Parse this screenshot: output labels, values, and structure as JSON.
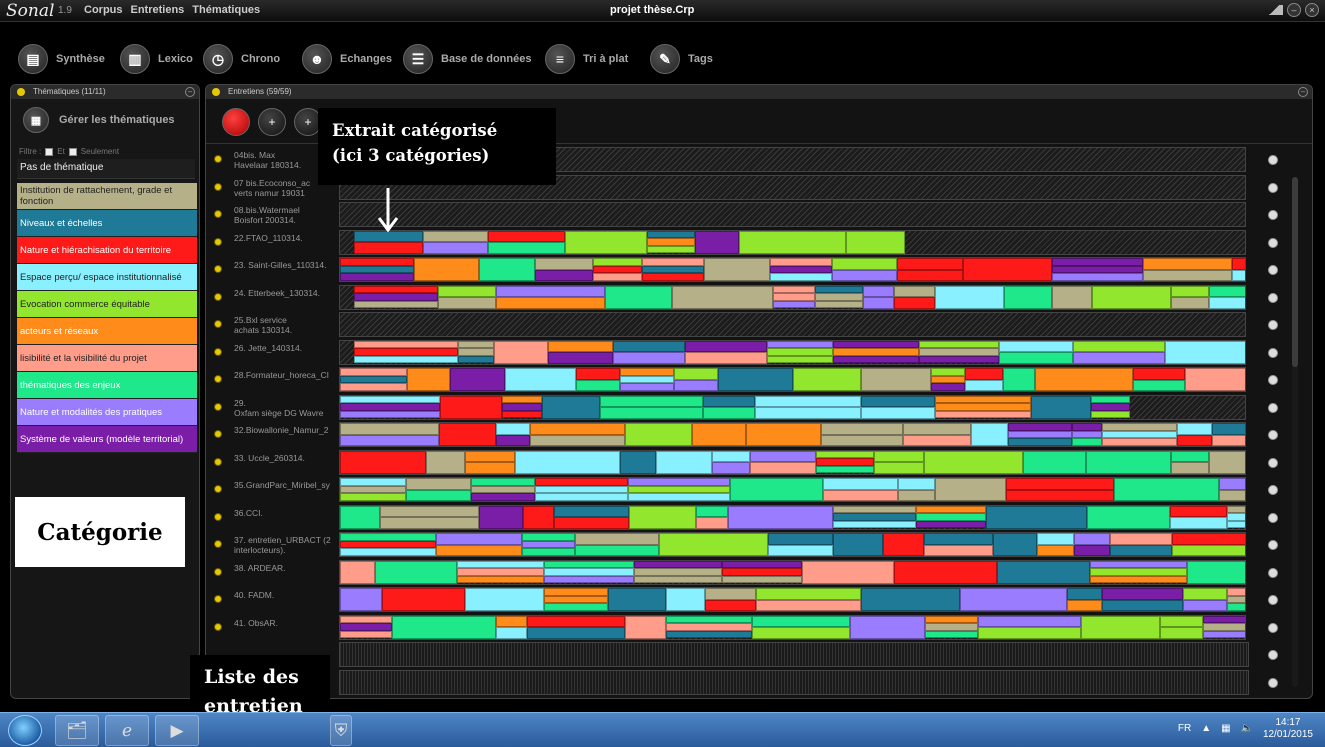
{
  "window": {
    "logo": "Sonal",
    "version": "1.9",
    "menu": [
      "Corpus",
      "Entretiens",
      "Thématiques"
    ],
    "title": "projet thèse.Crp"
  },
  "toolbar": [
    {
      "label": "Synthèse",
      "icon": "document-icon"
    },
    {
      "label": "Lexico",
      "icon": "lexicon-icon"
    },
    {
      "label": "Chrono",
      "icon": "clock-icon"
    },
    {
      "label": "Echanges",
      "icon": "people-icon"
    },
    {
      "label": "Base de données",
      "icon": "database-icon"
    },
    {
      "label": "Tri à plat",
      "icon": "sort-icon"
    },
    {
      "label": "Tags",
      "icon": "tag-icon"
    }
  ],
  "left_panel": {
    "header": "Thématiques (11/11)",
    "manage_label": "Gérer les thématiques",
    "filter": {
      "label": "Filtre :",
      "and": "Et",
      "only": "Seulement"
    },
    "no_theme": "Pas de thématique",
    "themes": [
      {
        "label": "Institution de rattachement, grade et fonction",
        "color": "#b5b087"
      },
      {
        "label": "Niveaux et échelles",
        "color": "#1e7a96"
      },
      {
        "label": "Nature et hiérachisation du territoire",
        "color": "#ff1a1a"
      },
      {
        "label": "Espace perçu/ espace institutionnalisé",
        "color": "#88f0ff"
      },
      {
        "label": "Evocation commerce équitable",
        "color": "#92e62e"
      },
      {
        "label": "acteurs et réseaux",
        "color": "#ff8c1a"
      },
      {
        "label": "lisibilité et la visibilité du projet",
        "color": "#ff9c8a"
      },
      {
        "label": "thématiques des enjeux",
        "color": "#1ee88a"
      },
      {
        "label": "Nature et modalités des pratiques",
        "color": "#9a7cff"
      },
      {
        "label": "Système de valeurs (modèle territorial)",
        "color": "#7a1ea8"
      }
    ]
  },
  "right_panel": {
    "header": "Entretiens (59/59)",
    "interviews": [
      {
        "name": "04bis. Max\nHavelaar  180314."
      },
      {
        "name": "07 bis.Ecoconso_ac\nverts  namur  19031"
      },
      {
        "name": "08.bis.Watermael\nBoisfort  200314."
      },
      {
        "name": "22.FTAO_110314."
      },
      {
        "name": "23. Saint-Gilles_110314."
      },
      {
        "name": "24. Etterbeek_130314."
      },
      {
        "name": "25.Bxl service\nachats  130314."
      },
      {
        "name": "26. Jette_140314."
      },
      {
        "name": "28.Formateur_horeca_CI"
      },
      {
        "name": "29.\nOxfam siège DG Wavre"
      },
      {
        "name": "32.Biowallonie_Namur_2"
      },
      {
        "name": "33. Uccle_260314."
      },
      {
        "name": "35.GrandParc_Miribel_sy"
      },
      {
        "name": "36.CCI."
      },
      {
        "name": "37. entretien_URBACT (2\ninterlocteurs)."
      },
      {
        "name": "38. ARDEAR."
      },
      {
        "name": "40. FADM."
      },
      {
        "name": "41. ObsAR."
      },
      {
        "name": ""
      },
      {
        "name": ""
      }
    ]
  },
  "annotations": {
    "extract": "Extrait catégorisé\n(ici 3 catégories)",
    "category": "Catégorie",
    "list": "Liste des\nentretien"
  },
  "taskbar": {
    "lang": "FR",
    "time": "14:17",
    "date": "12/01/2015"
  }
}
